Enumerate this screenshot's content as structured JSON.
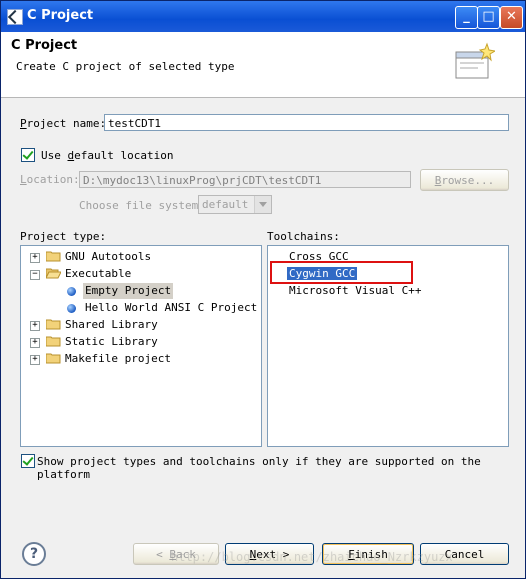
{
  "window": {
    "title": "C Project",
    "minimize": "_",
    "maximize": "□",
    "close": "✕"
  },
  "header": {
    "title": "C Project",
    "description": "Create C project of selected type",
    "icon": "new-project-wizard-icon"
  },
  "project_name": {
    "label": "Project name:",
    "value": "testCDT1"
  },
  "use_default_location": {
    "label": "Use default location",
    "checked": true
  },
  "location": {
    "label": "Location:",
    "value": "D:\\mydoc13\\linuxProg\\prjCDT\\testCDT1",
    "browse_label": "Browse..."
  },
  "file_system": {
    "label": "Choose file system:",
    "value": "default"
  },
  "project_type": {
    "label": "Project type:",
    "items": [
      {
        "label": "GNU Autotools",
        "expander": "+"
      },
      {
        "label": "Executable",
        "expander": "−"
      },
      {
        "label": "Empty Project",
        "selected": true
      },
      {
        "label": "Hello World ANSI C Project"
      },
      {
        "label": "Shared Library",
        "expander": "+"
      },
      {
        "label": "Static Library",
        "expander": "+"
      },
      {
        "label": "Makefile project",
        "expander": "+"
      }
    ]
  },
  "toolchains": {
    "label": "Toolchains:",
    "items": [
      {
        "label": "Cross GCC"
      },
      {
        "label": "Cygwin GCC",
        "selected": true
      },
      {
        "label": "Microsoft Visual C++"
      }
    ]
  },
  "show_supported": {
    "label": "Show project types and toolchains only if they are supported on the platform",
    "checked": true
  },
  "buttons": {
    "help": "?",
    "back": "< Back",
    "next": "Next >",
    "finish": "Finish",
    "cancel": "Cancel"
  },
  "watermark": "http://blog.csdn.net/zhaichao_Nzrkzyuzx",
  "colors": {
    "title_bar": "#0a4fd3",
    "selection": "#316ac5",
    "highlight_box": "#dd1111"
  }
}
